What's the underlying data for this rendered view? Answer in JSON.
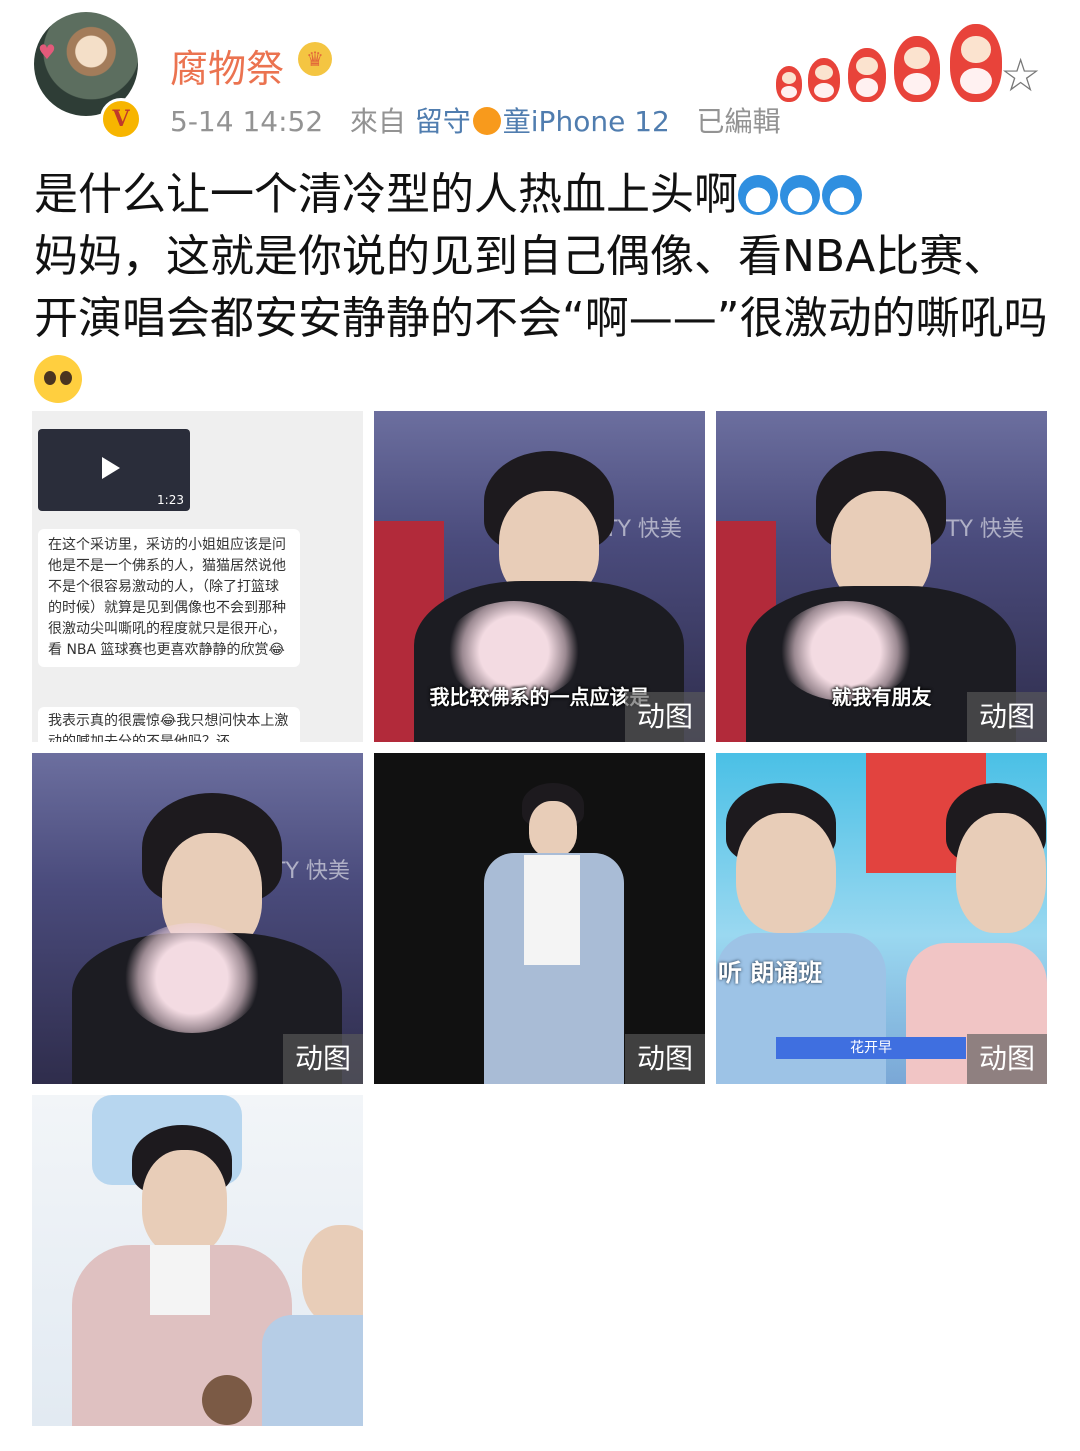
{
  "user": {
    "name": "腐物祭",
    "timestamp": "5-14 14:52",
    "from_label": "來自",
    "client_prefix": "留守",
    "client_suffix": "童iPhone 12",
    "edited": "已編輯",
    "verified_badge": "V"
  },
  "post": {
    "line1": "是什么让一个清冷型的人热血上头啊",
    "line2": "妈妈，这就是你说的见到自己偶像、看NBA比赛、",
    "line3": "开演唱会都安安静静的不会“啊——”很激动的嘶吼吗",
    "emojis": [
      "doraemon-emoji",
      "doraemon-emoji",
      "doraemon-emoji",
      "pleading-face-emoji"
    ]
  },
  "images": {
    "gif_label": "动图",
    "chat": {
      "video_time": "1:23",
      "message1": "在这个采访里，采访的小姐姐应该是问他是不是一个佛系的人，猫猫居然说他不是个很容易激动的人，（除了打篮球的时候）就算是见到偶像也不会到那种很激动尖叫嘶吼的程度就只是很开心，看 NBA 篮球赛也更喜欢静静的欣赏😂",
      "message2": "我表示真的很震惊😂我只想问快本上激动的喊加去分的不是他吗？还"
    },
    "subtitle2": "我比较佛系的一点应该是",
    "subtitle3": "就我有朋友",
    "stage_logo": "TY 快美",
    "side_banner": "听 朗诵班",
    "bottom_banner": "花开早"
  },
  "colors": {
    "username": "#eb7350",
    "meta": "#939393",
    "client_link": "#507daf",
    "text": "#111111"
  }
}
